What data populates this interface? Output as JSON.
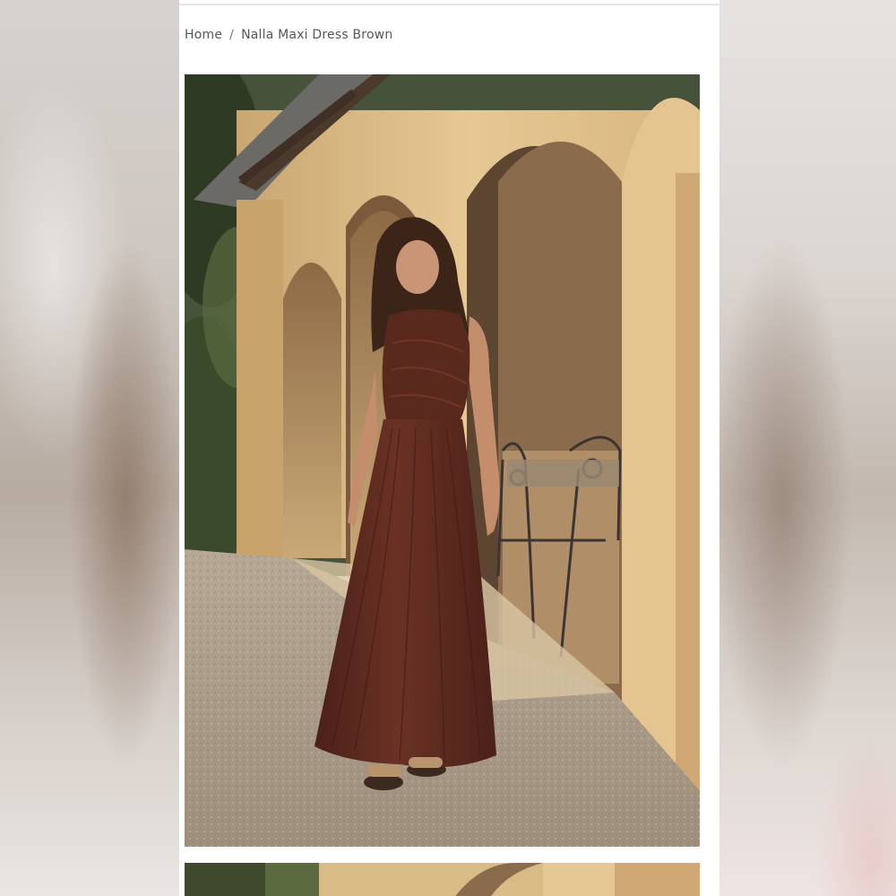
{
  "breadcrumb": {
    "home_label": "Home",
    "separator": "/",
    "current_label": "Nalla Maxi Dress Brown"
  },
  "product_gallery": {
    "images": [
      {
        "subject": "model-in-brown-maxi-dress",
        "role": "main"
      },
      {
        "subject": "model-in-brown-maxi-dress",
        "role": "secondary"
      }
    ]
  },
  "colors": {
    "dress": "#5a2a1f",
    "wall": "#e3c28f",
    "gravel": "#a89886",
    "foliage": "#3f4a2c"
  }
}
